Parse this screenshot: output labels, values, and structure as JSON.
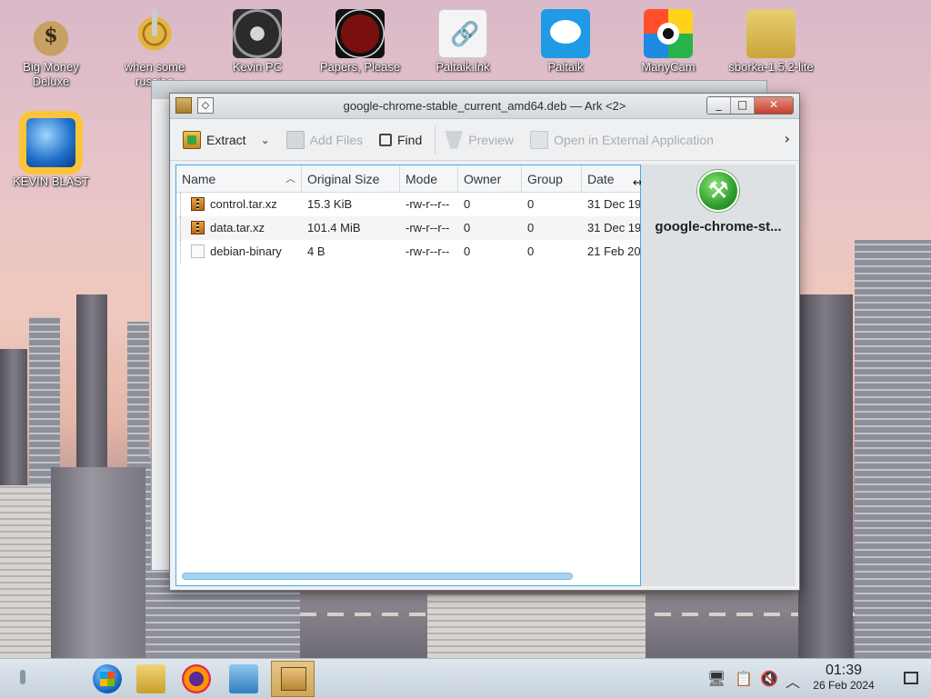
{
  "desktop": {
    "icons": [
      {
        "label": "Big Money\nDeluxe",
        "icon": "money-bag-icon"
      },
      {
        "label": "when some\nrussian",
        "icon": "gear-icon"
      },
      {
        "label": "Kevin PC",
        "icon": "gauge-icon"
      },
      {
        "label": "Papers, Please",
        "icon": "papers-please-icon"
      },
      {
        "label": "Paltalk.lnk",
        "icon": "shortcut-link-icon"
      },
      {
        "label": "Paltalk",
        "icon": "paltalk-icon"
      },
      {
        "label": "ManyCam",
        "icon": "manycam-icon"
      },
      {
        "label": "sborka-1.5.2-lite",
        "icon": "folder-icon"
      },
      {
        "label": "KEVIN BLAST",
        "icon": "globe-icon"
      }
    ]
  },
  "window": {
    "title": "google-chrome-stable_current_amd64.deb — Ark <2>",
    "controls": {
      "minimize": "_",
      "maximize": "□",
      "close": "✕"
    }
  },
  "toolbar": {
    "extract": "Extract",
    "add_files": "Add Files",
    "find": "Find",
    "preview": "Preview",
    "open_external": "Open in External Application"
  },
  "table": {
    "columns": [
      "Name",
      "Original Size",
      "Mode",
      "Owner",
      "Group",
      "Date"
    ],
    "rows": [
      {
        "name": "control.tar.xz",
        "size": "15.3 KiB",
        "mode": "-rw-r--r--",
        "owner": "0",
        "group": "0",
        "date": "31 Dec 19",
        "type": "archive"
      },
      {
        "name": "data.tar.xz",
        "size": "101.4 MiB",
        "mode": "-rw-r--r--",
        "owner": "0",
        "group": "0",
        "date": "31 Dec 19",
        "type": "archive"
      },
      {
        "name": "debian-binary",
        "size": "4 B",
        "mode": "-rw-r--r--",
        "owner": "0",
        "group": "0",
        "date": "21 Feb 20",
        "type": "text"
      }
    ]
  },
  "info_panel": {
    "name": "google-chrome-st...",
    "icon": "package-tools-icon"
  },
  "taskbar": {
    "clock_time": "01:39",
    "clock_date": "26 Feb 2024"
  },
  "colors": {
    "selection_accent": "#3daee9",
    "close_button": "#c2402c"
  }
}
